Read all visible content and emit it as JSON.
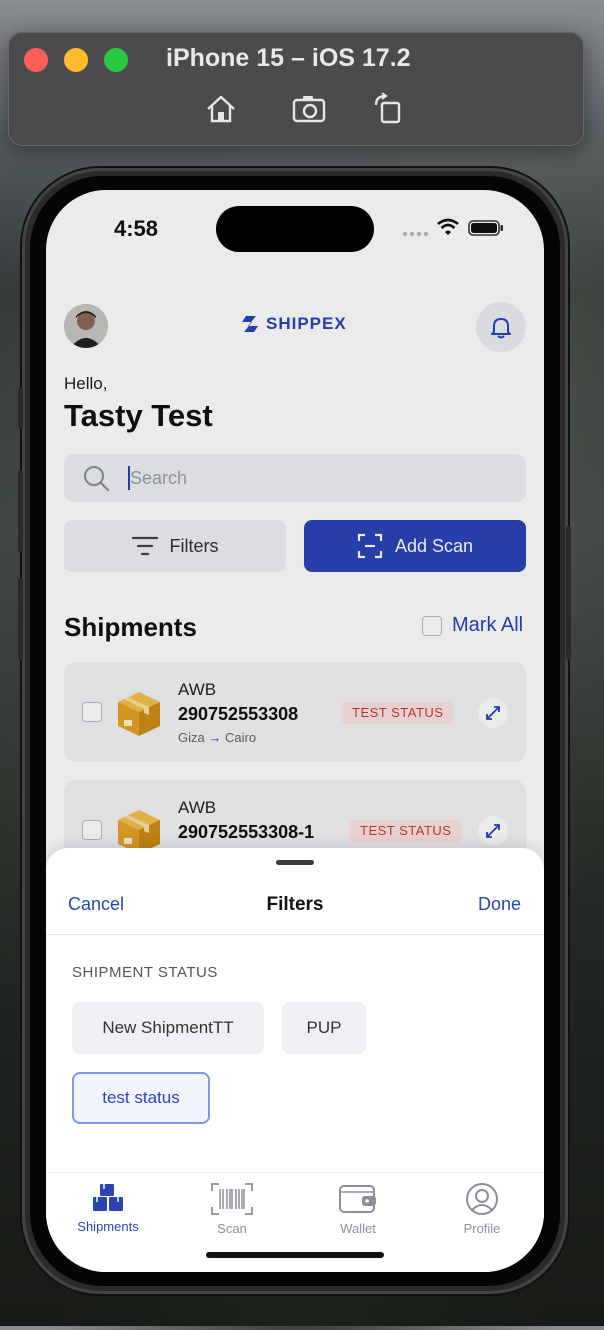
{
  "simulator": {
    "title": "iPhone 15 – iOS 17.2",
    "icons": [
      "home-icon",
      "screenshot-icon",
      "rotate-icon"
    ]
  },
  "status_bar": {
    "time": "4:58"
  },
  "header": {
    "brand": "SHIPPEX",
    "greeting": "Hello,",
    "user_name": "Tasty Test"
  },
  "search": {
    "placeholder": "Search"
  },
  "actions": {
    "filters_label": "Filters",
    "add_scan_label": "Add Scan"
  },
  "shipments": {
    "title": "Shipments",
    "mark_all_label": "Mark All",
    "items": [
      {
        "label": "AWB",
        "number": "290752553308",
        "status": "TEST STATUS",
        "from": "Giza",
        "to": "Cairo"
      },
      {
        "label": "AWB",
        "number": "290752553308-1",
        "status": "TEST STATUS"
      }
    ]
  },
  "filter_sheet": {
    "cancel_label": "Cancel",
    "title": "Filters",
    "done_label": "Done",
    "section_label": "SHIPMENT STATUS",
    "options": [
      {
        "label": "New ShipmentTT",
        "selected": false
      },
      {
        "label": "PUP",
        "selected": false
      },
      {
        "label": "test status",
        "selected": true
      }
    ]
  },
  "tab_bar": {
    "tabs": [
      {
        "label": "Shipments",
        "icon": "boxes-icon",
        "active": true
      },
      {
        "label": "Scan",
        "icon": "barcode-icon",
        "active": false
      },
      {
        "label": "Wallet",
        "icon": "wallet-icon",
        "active": false
      },
      {
        "label": "Profile",
        "icon": "profile-icon",
        "active": false
      }
    ]
  },
  "colors": {
    "brand": "#2a44b8",
    "status_text": "#c83a33",
    "status_bg": "#fbe3e1"
  }
}
